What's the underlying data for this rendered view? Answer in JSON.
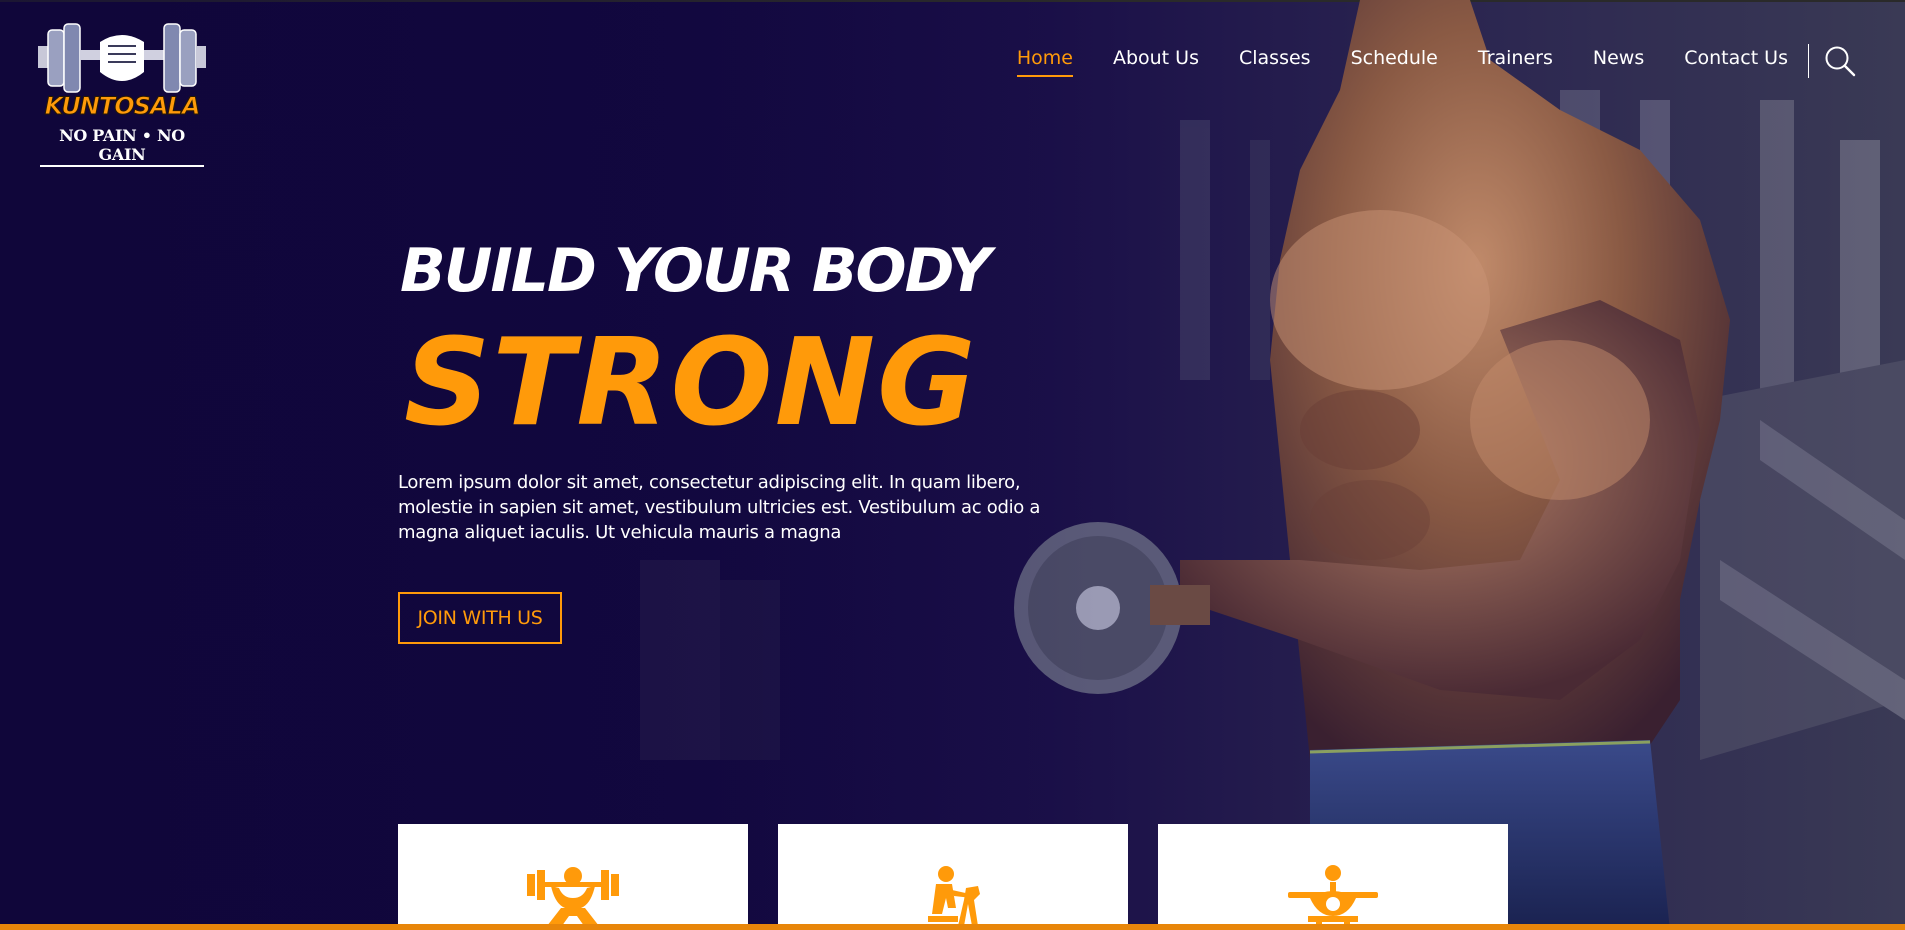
{
  "brand": {
    "name": "KUNTOSALA",
    "tagline": "NO PAIN • NO GAIN"
  },
  "nav": {
    "items": [
      {
        "label": "Home",
        "active": true
      },
      {
        "label": "About Us"
      },
      {
        "label": "Classes"
      },
      {
        "label": "Schedule"
      },
      {
        "label": "Trainers"
      },
      {
        "label": "News"
      },
      {
        "label": "Contact Us"
      }
    ],
    "search_icon": "search-icon"
  },
  "hero": {
    "headline": "BUILD YOUR BODY",
    "headline_accent": "STRONG",
    "description": "Lorem ipsum dolor sit amet, consectetur adipiscing elit. In quam libero, molestie in sapien sit amet, vestibulum ultricies est. Vestibulum ac odio a magna aliquet iaculis. Ut vehicula mauris a magna",
    "cta_label": "JOIN WITH US"
  },
  "features": [
    {
      "icon": "weightlifting-icon"
    },
    {
      "icon": "trainer-icon"
    },
    {
      "icon": "bench-press-icon"
    }
  ],
  "colors": {
    "accent": "#ff9a0a",
    "background": "#10063a",
    "text": "#ffffff"
  }
}
